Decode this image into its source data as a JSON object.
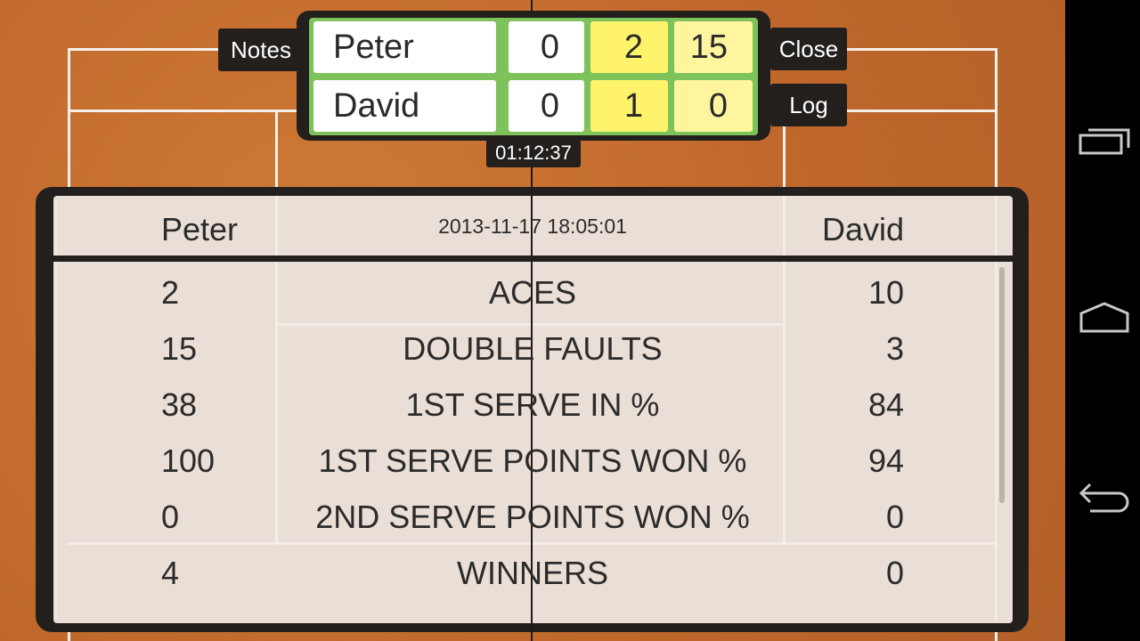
{
  "scoreboard": {
    "players": [
      {
        "name": "Peter",
        "sets": "0",
        "games": "2",
        "points": "15"
      },
      {
        "name": "David",
        "sets": "0",
        "games": "1",
        "points": "0"
      }
    ],
    "timer": "01:12:37"
  },
  "buttons": {
    "notes": "Notes",
    "close": "Close",
    "log": "Log"
  },
  "stats": {
    "left_player": "Peter",
    "right_player": "David",
    "datetime": "2013-11-17 18:05:01",
    "rows": [
      {
        "label": "ACES",
        "left": "2",
        "right": "10"
      },
      {
        "label": "DOUBLE FAULTS",
        "left": "15",
        "right": "3"
      },
      {
        "label": "1ST SERVE IN %",
        "left": "38",
        "right": "84"
      },
      {
        "label": "1ST SERVE POINTS WON %",
        "left": "100",
        "right": "94"
      },
      {
        "label": "2ND SERVE POINTS WON %",
        "left": "0",
        "right": "0"
      },
      {
        "label": "WINNERS",
        "left": "4",
        "right": "0"
      }
    ]
  },
  "nav": {
    "icons": [
      "recent-apps-icon",
      "home-icon",
      "back-icon"
    ]
  },
  "colors": {
    "court": "#c46c2e",
    "games": "#fff36c",
    "points": "#fff59e",
    "board": "#7dc25a"
  }
}
